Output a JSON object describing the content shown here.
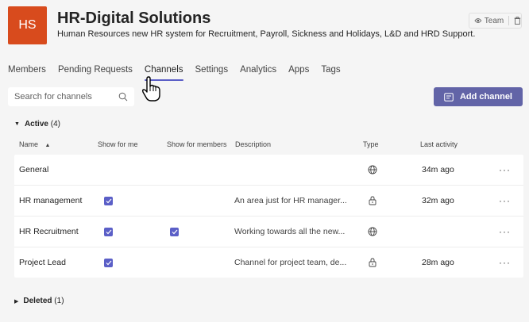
{
  "team": {
    "initials": "HS",
    "name": "HR-Digital Solutions",
    "description": "Human Resources new HR system for Recruitment, Payroll, Sickness and Holidays, L&D and HRD Support.",
    "badge": "Team",
    "more": "···"
  },
  "tabs": [
    {
      "label": "Members"
    },
    {
      "label": "Pending Requests"
    },
    {
      "label": "Channels",
      "active": true
    },
    {
      "label": "Settings"
    },
    {
      "label": "Analytics"
    },
    {
      "label": "Apps"
    },
    {
      "label": "Tags"
    }
  ],
  "search": {
    "placeholder": "Search for channels"
  },
  "add_channel": {
    "label": "Add channel"
  },
  "active_section": {
    "label": "Active",
    "count": "(4)"
  },
  "deleted_section": {
    "label": "Deleted",
    "count": "(1)"
  },
  "columns": {
    "name": "Name",
    "show_for_me": "Show for me",
    "show_for_members": "Show for members",
    "description": "Description",
    "type": "Type",
    "last_activity": "Last activity"
  },
  "rows": [
    {
      "name": "General",
      "show_for_me": false,
      "show_for_members": false,
      "description": "",
      "type": "globe-icon",
      "last_activity": "34m ago"
    },
    {
      "name": "HR management",
      "show_for_me": true,
      "show_for_members": false,
      "description": "An area just for HR manager...",
      "type": "lock-icon",
      "last_activity": "32m ago"
    },
    {
      "name": "HR Recruitment",
      "show_for_me": true,
      "show_for_members": true,
      "description": "Working towards all the new...",
      "type": "globe-icon",
      "last_activity": ""
    },
    {
      "name": "Project Lead",
      "show_for_me": true,
      "show_for_members": false,
      "description": "Channel for project team, de...",
      "type": "lock-icon",
      "last_activity": "28m ago"
    }
  ],
  "row_more": "···",
  "colors": {
    "accent": "#6264a7",
    "tab_underline": "#5b5fc7",
    "logo": "#d84b1d",
    "background": "#f5f5f5"
  }
}
